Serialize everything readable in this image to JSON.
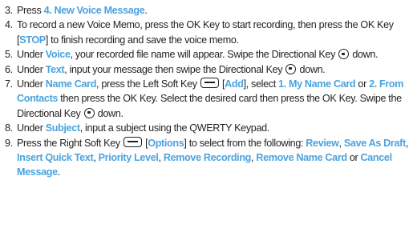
{
  "colors": {
    "highlight": "#4aa3df",
    "text": "#231f20"
  },
  "icons": {
    "soft_key": "soft-key-icon",
    "directional_key": "directional-key-icon"
  },
  "steps": [
    {
      "num": "3.",
      "t1": "Press ",
      "b1": "4. New Voice Message",
      "t2": "."
    },
    {
      "num": "4.",
      "t1": "To record a new Voice Memo, press the OK Key to start recording, then press the OK Key [",
      "b1": "STOP",
      "t2": "] to finish recording and save the voice memo."
    },
    {
      "num": "5.",
      "t1": "Under ",
      "b1": "Voice",
      "t2": ", your recorded file name will appear. Swipe the Directional Key ",
      "t3": " down."
    },
    {
      "num": "6.",
      "t1": "Under ",
      "b1": "Text",
      "t2": ", input your message then swipe the Directional Key ",
      "t3": " down."
    },
    {
      "num": "7.",
      "t1": "Under ",
      "b1": "Name Card",
      "t2": ", press the Left Soft Key ",
      "t3": " [",
      "b2": "Add",
      "t4": "], select ",
      "b3": "1. My Name Card",
      "t5": " or ",
      "b4": "2. From Contacts",
      "t6": " then press the OK Key. Select the desired card then press the OK Key. Swipe the Directional Key ",
      "t7": " down."
    },
    {
      "num": "8.",
      "t1": "Under ",
      "b1": "Subject",
      "t2": ", input a subject using the QWERTY Keypad."
    },
    {
      "num": "9.",
      "t1": "Press the Right Soft Key ",
      "t2": " [",
      "b1": "Options",
      "t3": "] to select from the following: ",
      "b2": "Review",
      "s1": ", ",
      "b3": "Save As Draft",
      "s2": ", ",
      "b4": "Insert Quick Text",
      "s3": ", ",
      "b5": "Priority Level",
      "s4": ", ",
      "b6": "Remove Recording",
      "s5": ", ",
      "b7": "Remove Name Card",
      "s6": " or ",
      "b8": "Cancel Message",
      "s7": "."
    }
  ]
}
